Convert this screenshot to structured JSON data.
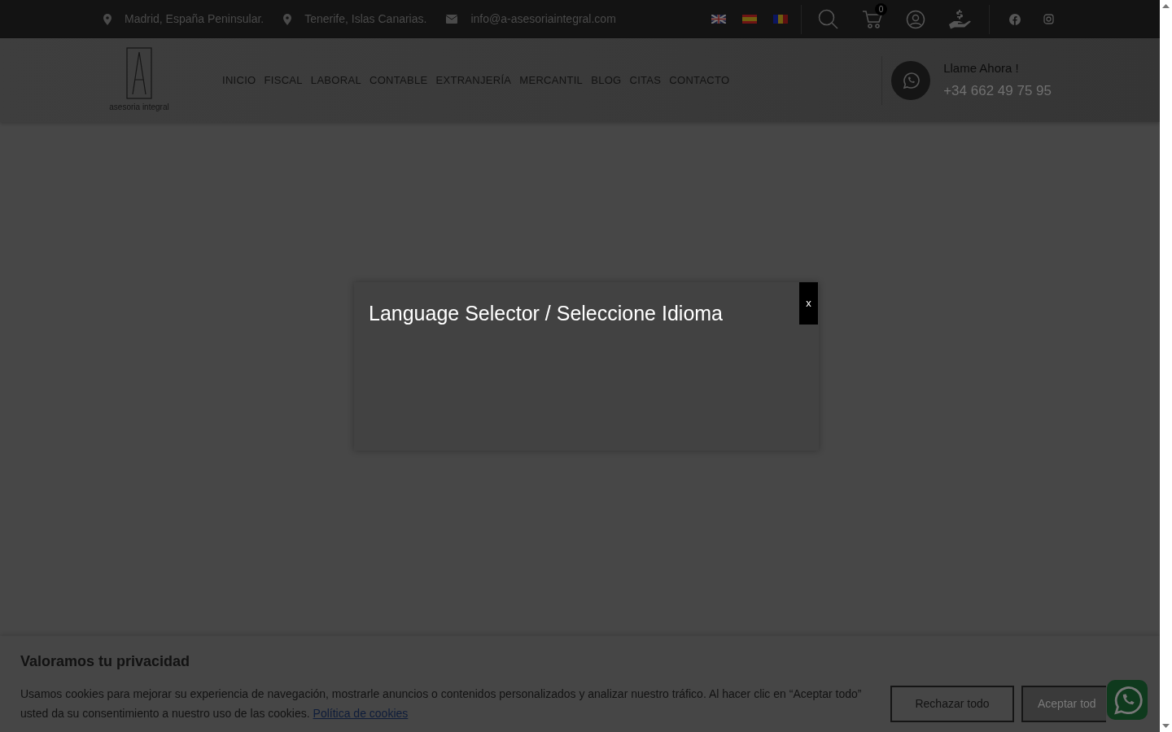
{
  "top_bar": {
    "contacts": [
      {
        "kind": "pin",
        "text": "Madrid, España Peninsular."
      },
      {
        "kind": "pin",
        "text": "Tenerife, Islas Canarias."
      },
      {
        "kind": "mail",
        "text": "info@a-asesoriaintegral.com"
      }
    ],
    "cart_count": "0"
  },
  "header": {
    "logo_text": "asesoria integral",
    "nav": [
      "INICIO",
      "FISCAL",
      "LABORAL",
      "CONTABLE",
      "EXTRANJERÍA",
      "MERCANTIL",
      "BLOG",
      "CITAS",
      "CONTACTO"
    ],
    "call_label": "Llame Ahora !",
    "phone": "+34 662 49 75 95"
  },
  "modal": {
    "title": "Language Selector / Seleccione Idioma",
    "close": "x"
  },
  "cookie_banner": {
    "title": "Valoramos tu privacidad",
    "text": "Usamos cookies para mejorar su experiencia de navegación, mostrarle anuncios o contenidos personalizados y analizar nuestro tráfico. Al hacer clic en “Aceptar todo” usted da su consentimiento a nuestro uso de las cookies.",
    "link": "Política de cookies",
    "buttons": [
      "Rechazar todo",
      "Aceptar tod"
    ]
  }
}
